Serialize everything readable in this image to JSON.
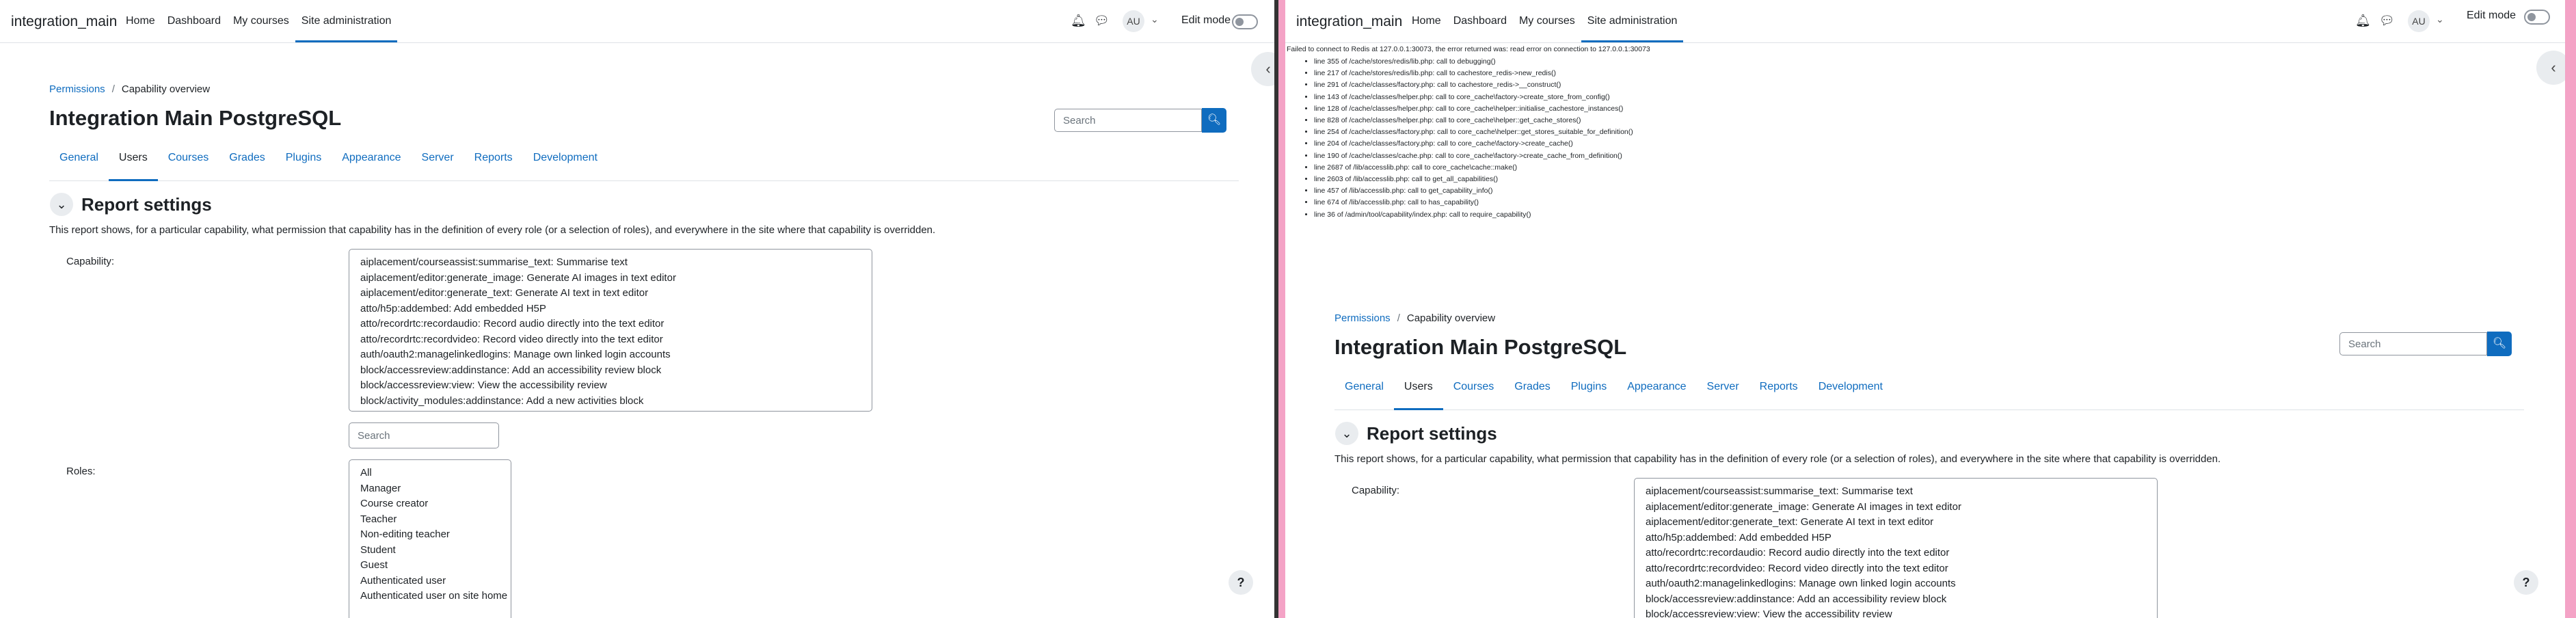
{
  "site_name": "integration_main",
  "nav": [
    "Home",
    "Dashboard",
    "My courses",
    "Site administration"
  ],
  "user_initials": "AU",
  "edit_mode_label": "Edit mode",
  "breadcrumb": {
    "first": "Permissions",
    "sep": "/",
    "current": "Capability overview"
  },
  "page_title": "Integration Main PostgreSQL",
  "search_placeholder": "Search",
  "tabs": [
    "General",
    "Users",
    "Courses",
    "Grades",
    "Plugins",
    "Appearance",
    "Server",
    "Reports",
    "Development"
  ],
  "active_tab": "Users",
  "section_title": "Report settings",
  "description": "This report shows, for a particular capability, what permission that capability has in the definition of every role (or a selection of roles), and everywhere in the site where that capability is overridden.",
  "capability_label": "Capability:",
  "capabilities": [
    "aiplacement/courseassist:summarise_text: Summarise text",
    "aiplacement/editor:generate_image: Generate AI images in text editor",
    "aiplacement/editor:generate_text: Generate AI text in text editor",
    "atto/h5p:addembed: Add embedded H5P",
    "atto/recordrtc:recordaudio: Record audio directly into the text editor",
    "atto/recordrtc:recordvideo: Record video directly into the text editor",
    "auth/oauth2:managelinkedlogins: Manage own linked login accounts",
    "block/accessreview:addinstance: Add an accessibility review block",
    "block/accessreview:view: View the accessibility review",
    "block/activity_modules:addinstance: Add a new activities block"
  ],
  "filter_placeholder": "Search",
  "roles_label": "Roles:",
  "roles": [
    "All",
    "Manager",
    "Course creator",
    "Teacher",
    "Non-editing teacher",
    "Student",
    "Guest",
    "Authenticated user",
    "Authenticated user on site home"
  ],
  "help_label": "?",
  "debug": {
    "message": "Failed to connect to Redis at 127.0.0.1:30073, the error returned was: read error on connection to 127.0.0.1:30073",
    "lines": [
      "line 355 of /cache/stores/redis/lib.php: call to debugging()",
      "line 217 of /cache/stores/redis/lib.php: call to cachestore_redis->new_redis()",
      "line 291 of /cache/classes/factory.php: call to cachestore_redis->__construct()",
      "line 143 of /cache/classes/helper.php: call to core_cache\\factory->create_store_from_config()",
      "line 128 of /cache/classes/helper.php: call to core_cache\\helper::initialise_cachestore_instances()",
      "line 828 of /cache/classes/helper.php: call to core_cache\\helper::get_cache_stores()",
      "line 254 of /cache/classes/factory.php: call to core_cache\\helper::get_stores_suitable_for_definition()",
      "line 204 of /cache/classes/factory.php: call to core_cache\\factory->create_cache()",
      "line 190 of /cache/classes/cache.php: call to core_cache\\factory->create_cache_from_definition()",
      "line 2687 of /lib/accesslib.php: call to core_cache\\cache::make()",
      "line 2603 of /lib/accesslib.php: call to get_all_capabilities()",
      "line 457 of /lib/accesslib.php: call to get_capability_info()",
      "line 674 of /lib/accesslib.php: call to has_capability()",
      "line 36 of /admin/tool/capability/index.php: call to require_capability()"
    ]
  }
}
